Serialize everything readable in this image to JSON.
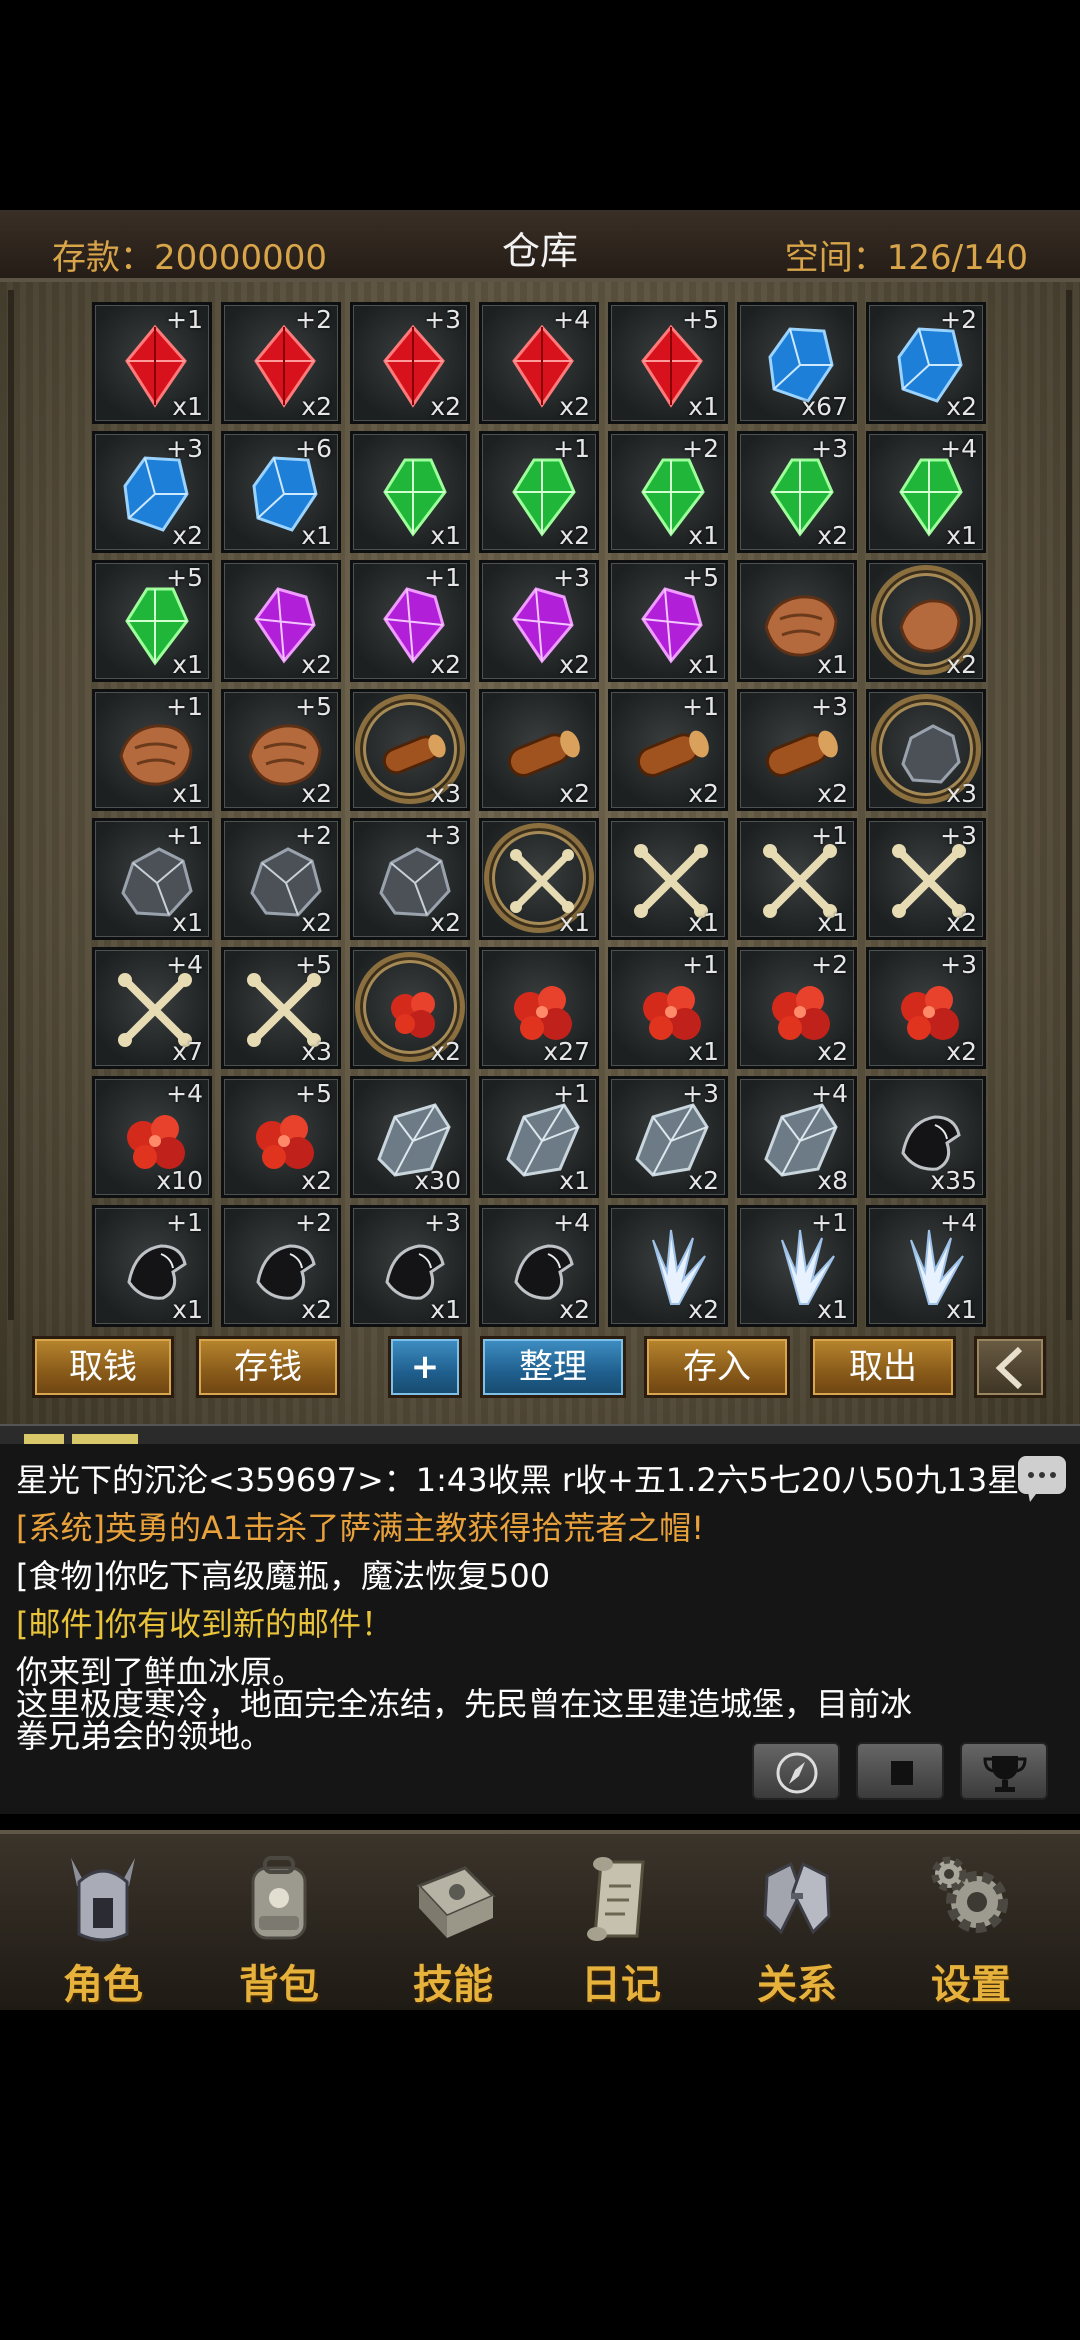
{
  "header": {
    "balance_label": "存款：20000000",
    "title": "仓库",
    "space_label": "空间：126/140"
  },
  "grid": {
    "items": [
      {
        "plus": "+1",
        "count": "x1",
        "icon": "red-gem"
      },
      {
        "plus": "+2",
        "count": "x2",
        "icon": "red-gem"
      },
      {
        "plus": "+3",
        "count": "x2",
        "icon": "red-gem"
      },
      {
        "plus": "+4",
        "count": "x2",
        "icon": "red-gem"
      },
      {
        "plus": "+5",
        "count": "x1",
        "icon": "red-gem"
      },
      {
        "plus": "",
        "count": "x67",
        "icon": "blue-gem"
      },
      {
        "plus": "+2",
        "count": "x2",
        "icon": "blue-gem"
      },
      {
        "plus": "+3",
        "count": "x2",
        "icon": "blue-gem"
      },
      {
        "plus": "+6",
        "count": "x1",
        "icon": "blue-gem"
      },
      {
        "plus": "",
        "count": "x1",
        "icon": "green-gem"
      },
      {
        "plus": "+1",
        "count": "x2",
        "icon": "green-gem"
      },
      {
        "plus": "+2",
        "count": "x1",
        "icon": "green-gem"
      },
      {
        "plus": "+3",
        "count": "x2",
        "icon": "green-gem"
      },
      {
        "plus": "+4",
        "count": "x1",
        "icon": "green-gem"
      },
      {
        "plus": "+5",
        "count": "x1",
        "icon": "green-gem"
      },
      {
        "plus": "",
        "count": "x2",
        "icon": "purple-gem"
      },
      {
        "plus": "+1",
        "count": "x2",
        "icon": "purple-gem"
      },
      {
        "plus": "+3",
        "count": "x2",
        "icon": "purple-gem"
      },
      {
        "plus": "+5",
        "count": "x1",
        "icon": "purple-gem"
      },
      {
        "plus": "",
        "count": "x1",
        "icon": "hide"
      },
      {
        "plus": "",
        "count": "x2",
        "icon": "hide-ring"
      },
      {
        "plus": "+1",
        "count": "x1",
        "icon": "hide"
      },
      {
        "plus": "+5",
        "count": "x2",
        "icon": "hide"
      },
      {
        "plus": "",
        "count": "x3",
        "icon": "log-ring"
      },
      {
        "plus": "",
        "count": "x2",
        "icon": "log"
      },
      {
        "plus": "+1",
        "count": "x2",
        "icon": "log"
      },
      {
        "plus": "+3",
        "count": "x2",
        "icon": "log"
      },
      {
        "plus": "",
        "count": "x3",
        "icon": "ore-ring"
      },
      {
        "plus": "+1",
        "count": "x1",
        "icon": "ore"
      },
      {
        "plus": "+2",
        "count": "x2",
        "icon": "ore"
      },
      {
        "plus": "+3",
        "count": "x2",
        "icon": "ore"
      },
      {
        "plus": "",
        "count": "x1",
        "icon": "bone-ring"
      },
      {
        "plus": "",
        "count": "x1",
        "icon": "bone"
      },
      {
        "plus": "+1",
        "count": "x1",
        "icon": "bone"
      },
      {
        "plus": "+3",
        "count": "x2",
        "icon": "bone"
      },
      {
        "plus": "+4",
        "count": "x7",
        "icon": "bone"
      },
      {
        "plus": "+5",
        "count": "x3",
        "icon": "bone"
      },
      {
        "plus": "",
        "count": "x2",
        "icon": "meat-ring"
      },
      {
        "plus": "",
        "count": "x27",
        "icon": "meat"
      },
      {
        "plus": "+1",
        "count": "x1",
        "icon": "meat"
      },
      {
        "plus": "+2",
        "count": "x2",
        "icon": "meat"
      },
      {
        "plus": "+3",
        "count": "x2",
        "icon": "meat"
      },
      {
        "plus": "+4",
        "count": "x10",
        "icon": "meat"
      },
      {
        "plus": "+5",
        "count": "x2",
        "icon": "meat"
      },
      {
        "plus": "",
        "count": "x30",
        "icon": "crystal"
      },
      {
        "plus": "+1",
        "count": "x1",
        "icon": "crystal"
      },
      {
        "plus": "+3",
        "count": "x2",
        "icon": "crystal"
      },
      {
        "plus": "+4",
        "count": "x8",
        "icon": "crystal"
      },
      {
        "plus": "",
        "count": "x35",
        "icon": "cloth"
      },
      {
        "plus": "+1",
        "count": "x1",
        "icon": "cloth"
      },
      {
        "plus": "+2",
        "count": "x2",
        "icon": "cloth"
      },
      {
        "plus": "+3",
        "count": "x1",
        "icon": "cloth"
      },
      {
        "plus": "+4",
        "count": "x2",
        "icon": "cloth"
      },
      {
        "plus": "",
        "count": "x2",
        "icon": "shard"
      },
      {
        "plus": "+1",
        "count": "x1",
        "icon": "shard"
      },
      {
        "plus": "+4",
        "count": "x1",
        "icon": "shard"
      }
    ]
  },
  "buttons": {
    "withdraw_money": "取钱",
    "deposit_money": "存钱",
    "expand": "+",
    "sort": "整理",
    "store": "存入",
    "take_out": "取出"
  },
  "chat": {
    "line1": "星光下的沉沦<359697>：1:43收黑 r收+五1.2六5七20八50九13星",
    "line2": "[系统]英勇的A1击杀了萨满主教获得拾荒者之帽!",
    "line3": "[食物]你吃下高级魔瓶，魔法恢复500",
    "line4": "[邮件]你有收到新的邮件！",
    "line5": "你来到了鲜血冰原。",
    "line6": "这里极度寒冷，地面完全冻结，先民曾在这里建造城堡，目前冰",
    "line7": "拳兄弟会的领地。"
  },
  "colors": {
    "system": "#e9a23b",
    "mail": "#e9c43b",
    "gold": "#d9a54a"
  },
  "nav": {
    "character": "角色",
    "bag": "背包",
    "skills": "技能",
    "diary": "日记",
    "relations": "关系",
    "settings": "设置"
  }
}
